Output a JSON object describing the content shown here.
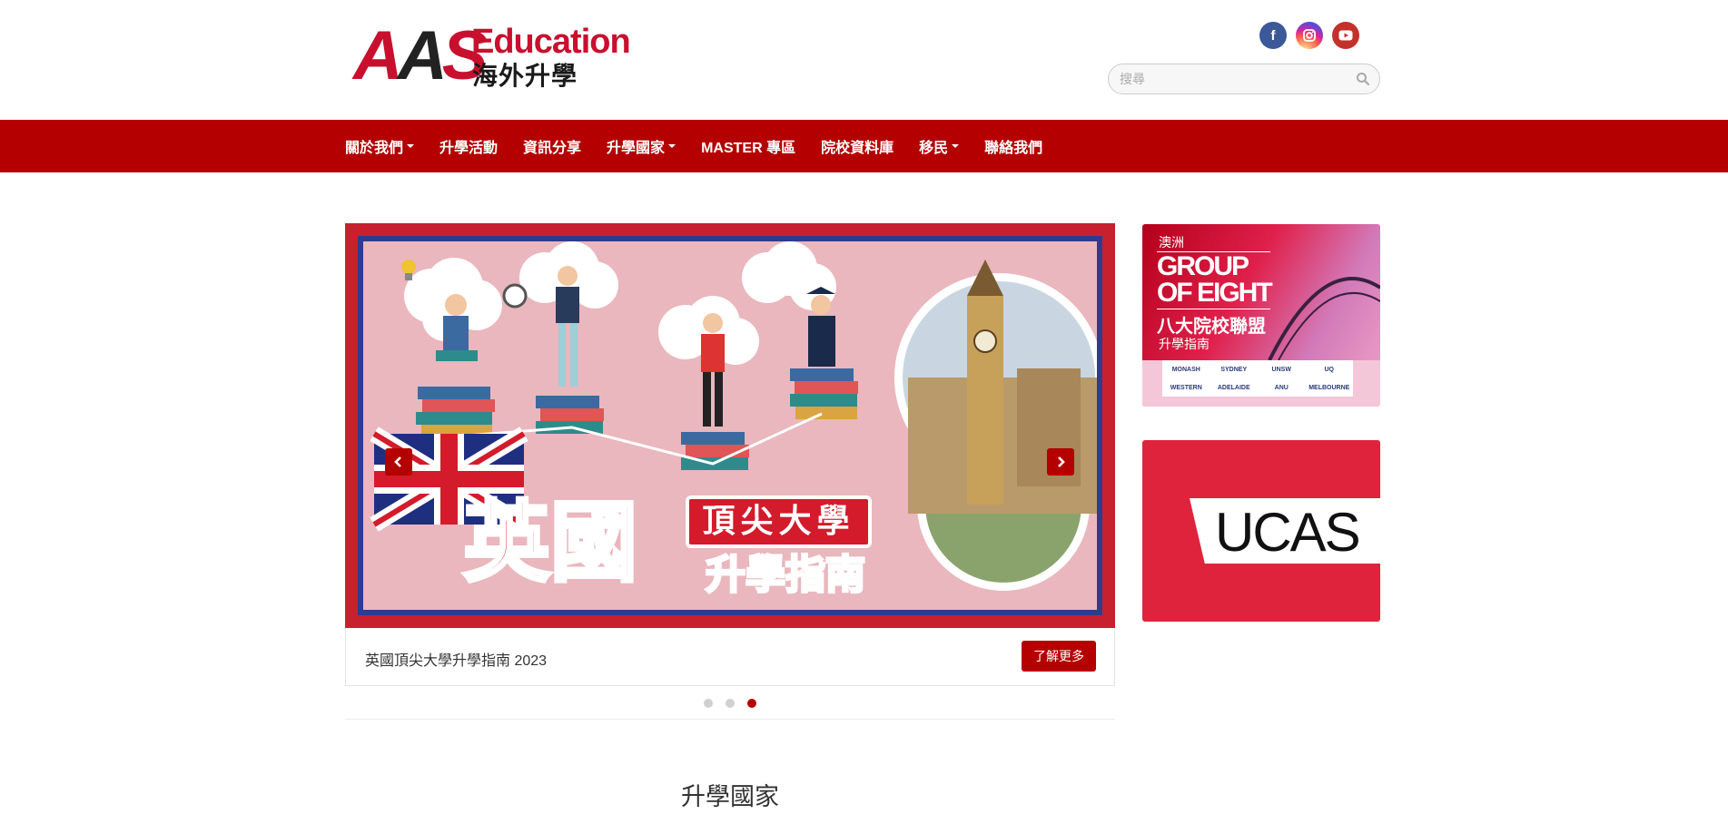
{
  "header": {
    "logo": {
      "brand": "AAS",
      "education": "Education",
      "subtitle": "海外升學"
    },
    "socials": [
      {
        "name": "facebook",
        "glyph": "f"
      },
      {
        "name": "instagram",
        "glyph": "◎"
      },
      {
        "name": "youtube",
        "glyph": "▶"
      }
    ],
    "search": {
      "placeholder": "搜尋",
      "value": ""
    }
  },
  "nav": {
    "items": [
      {
        "label": "關於我們",
        "dropdown": true
      },
      {
        "label": "升學活動",
        "dropdown": false
      },
      {
        "label": "資訊分享",
        "dropdown": false
      },
      {
        "label": "升學國家",
        "dropdown": true
      },
      {
        "label": "MASTER 專區",
        "dropdown": false
      },
      {
        "label": "院校資料庫",
        "dropdown": false
      },
      {
        "label": "移民",
        "dropdown": true
      },
      {
        "label": "聯絡我們",
        "dropdown": false
      }
    ]
  },
  "carousel": {
    "slide": {
      "title_big": "英國",
      "badge_top": "頂尖大學",
      "badge_bottom": "升學指南"
    },
    "caption": "英國頂尖大學升學指南 2023",
    "button_label": "了解更多",
    "dots": 3,
    "active_dot": 3
  },
  "ads": {
    "go8": {
      "region": "澳洲",
      "line1": "GROUP",
      "line2": "OF EIGHT",
      "zh": "八大院校聯盟",
      "sub": "升學指南",
      "logos": [
        "MONASH",
        "SYDNEY",
        "UNSW",
        "UQ",
        "WESTERN",
        "ADELAIDE",
        "ANU",
        "MELBOURNE"
      ]
    },
    "ucas": {
      "text": "UCAS"
    }
  },
  "section": {
    "title": "升學國家"
  },
  "colors": {
    "primary": "#b40000",
    "facebook": "#3b5998",
    "youtube": "#c4302b"
  }
}
